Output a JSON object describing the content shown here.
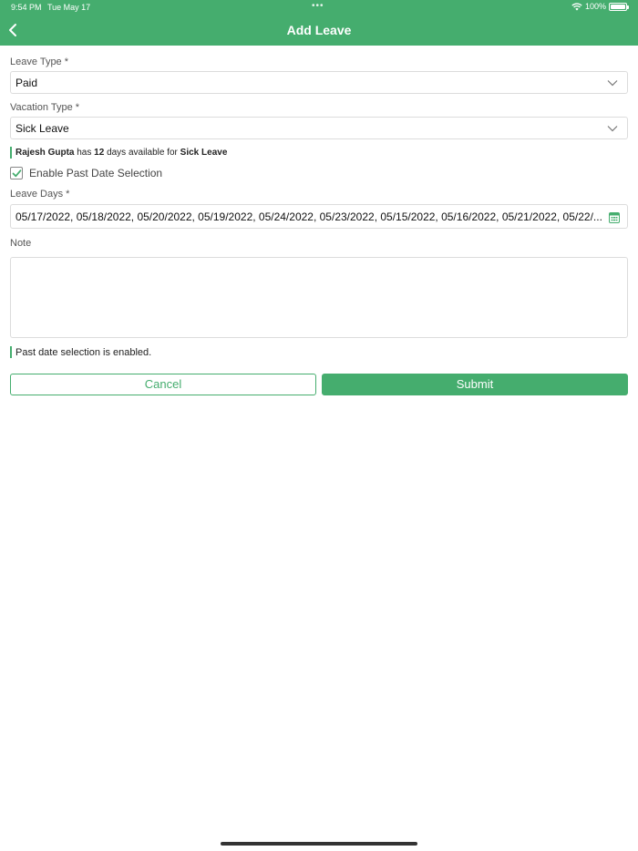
{
  "status_bar": {
    "time": "9:54 PM",
    "date": "Tue May 17",
    "battery": "100%"
  },
  "header": {
    "title": "Add Leave"
  },
  "form": {
    "leave_type": {
      "label": "Leave Type *",
      "value": "Paid"
    },
    "vacation_type": {
      "label": "Vacation Type *",
      "value": "Sick Leave"
    },
    "availability": {
      "name": "Rajesh Gupta",
      "has": "has",
      "days": "12",
      "middle": "days available for",
      "leave": "Sick Leave"
    },
    "past_date_checkbox": {
      "label": "Enable Past Date Selection",
      "checked": true
    },
    "leave_days": {
      "label": "Leave Days *",
      "value": "05/17/2022, 05/18/2022, 05/20/2022, 05/19/2022, 05/24/2022, 05/23/2022, 05/15/2022, 05/16/2022, 05/21/2022, 05/22/..."
    },
    "note": {
      "label": "Note",
      "value": ""
    },
    "past_date_notice": "Past date selection is enabled."
  },
  "buttons": {
    "cancel": "Cancel",
    "submit": "Submit"
  },
  "colors": {
    "accent": "#45ad6e"
  }
}
